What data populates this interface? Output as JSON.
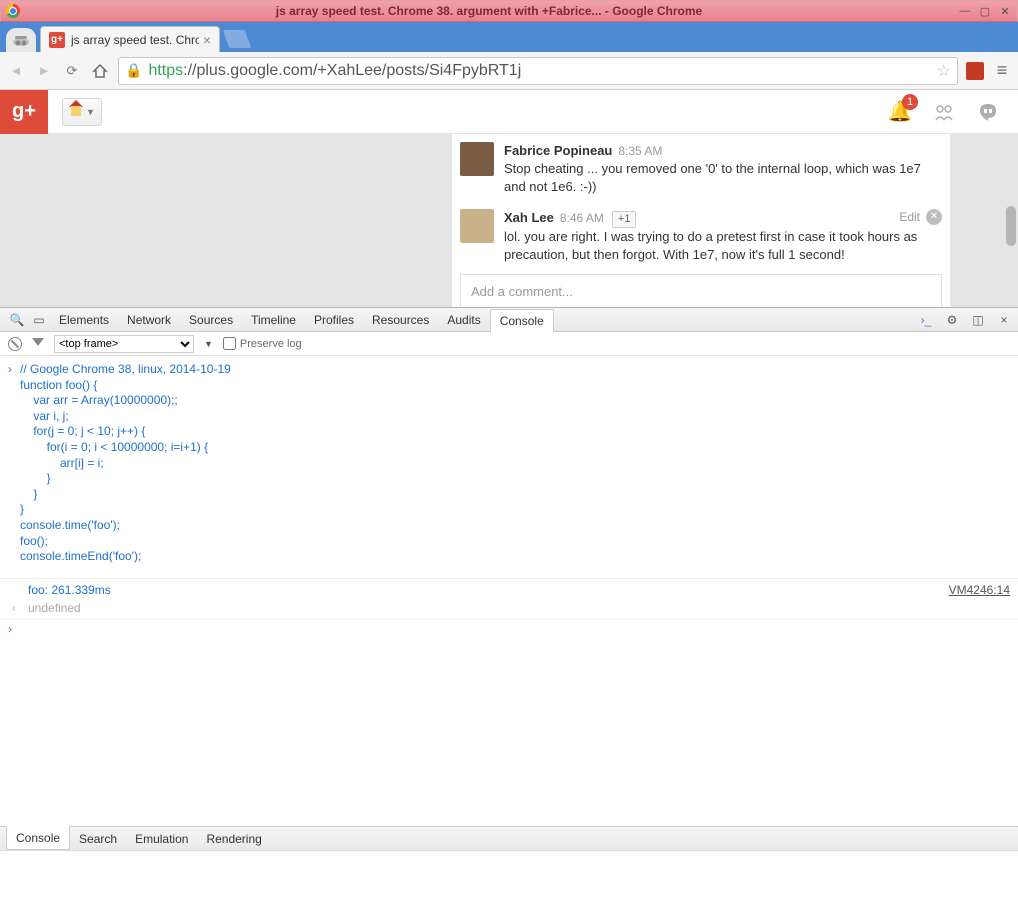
{
  "window_title": "js array speed test. Chrome 38. argument with +Fabrice... - Google Chrome",
  "tab": {
    "title": "js array speed test. Chro",
    "favicon": "g+"
  },
  "url": {
    "https": "https",
    "rest": "://plus.google.com/+XahLee/posts/Si4FpybRT1j"
  },
  "gplus": {
    "logo": "g+",
    "notifications": "1"
  },
  "comments": [
    {
      "name": "Fabrice Popineau",
      "time": "8:35 AM",
      "text": "Stop cheating ... you removed one '0' to the internal loop, which was 1e7 and not 1e6. :-))"
    },
    {
      "name": "Xah Lee",
      "time": "8:46 AM",
      "plusone": "+1",
      "edit": "Edit",
      "text": "lol. you are right. I was trying to do a pretest first in case it took hours as precaution, but then forgot. With 1e7, now it's full 1 second!"
    }
  ],
  "add_comment": "Add a comment...",
  "devtools": {
    "tabs": [
      "Elements",
      "Network",
      "Sources",
      "Timeline",
      "Profiles",
      "Resources",
      "Audits",
      "Console"
    ],
    "active_tab": "Console",
    "frame": "<top frame>",
    "preserve": "Preserve log",
    "code": "// Google Chrome 38, linux, 2014-10-19\nfunction foo() {\n    var arr = Array(10000000);;\n    var i, j;\n    for(j = 0; j < 10; j++) {\n        for(i = 0; i < 10000000; i=i+1) {\n            arr[i] = i;\n        }\n    }\n}\nconsole.time('foo');\nfoo();\nconsole.timeEnd('foo');",
    "result": "foo: 261.339ms",
    "source": "VM4246:14",
    "undefined": "undefined",
    "bottom_tabs": [
      "Console",
      "Search",
      "Emulation",
      "Rendering"
    ],
    "bottom_active": "Console"
  }
}
